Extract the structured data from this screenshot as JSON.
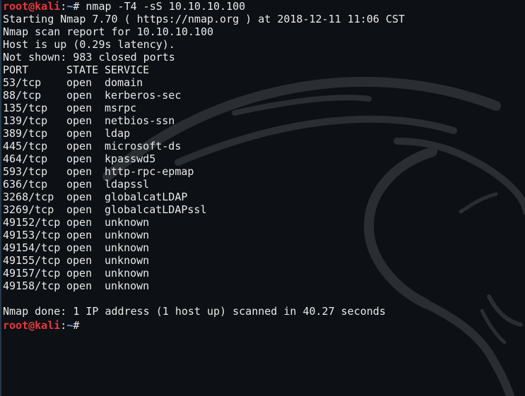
{
  "colors": {
    "background": "#0d1014",
    "text": "#e9e9e9",
    "prompt_user": "#e8383d",
    "prompt_path": "#6aa6f0"
  },
  "prompt": {
    "user": "root@kali",
    "sep": ":",
    "path": "~",
    "symbol": "# "
  },
  "command": "nmap -T4 -sS 10.10.10.100",
  "header_lines": [
    "Starting Nmap 7.70 ( https://nmap.org ) at 2018-12-11 11:06 CST",
    "Nmap scan report for 10.10.10.100",
    "Host is up (0.29s latency).",
    "Not shown: 983 closed ports"
  ],
  "table": {
    "headers": [
      "PORT",
      "STATE",
      "SERVICE"
    ],
    "rows": [
      [
        "53/tcp",
        "open",
        "domain"
      ],
      [
        "88/tcp",
        "open",
        "kerberos-sec"
      ],
      [
        "135/tcp",
        "open",
        "msrpc"
      ],
      [
        "139/tcp",
        "open",
        "netbios-ssn"
      ],
      [
        "389/tcp",
        "open",
        "ldap"
      ],
      [
        "445/tcp",
        "open",
        "microsoft-ds"
      ],
      [
        "464/tcp",
        "open",
        "kpasswd5"
      ],
      [
        "593/tcp",
        "open",
        "http-rpc-epmap"
      ],
      [
        "636/tcp",
        "open",
        "ldapssl"
      ],
      [
        "3268/tcp",
        "open",
        "globalcatLDAP"
      ],
      [
        "3269/tcp",
        "open",
        "globalcatLDAPssl"
      ],
      [
        "49152/tcp",
        "open",
        "unknown"
      ],
      [
        "49153/tcp",
        "open",
        "unknown"
      ],
      [
        "49154/tcp",
        "open",
        "unknown"
      ],
      [
        "49155/tcp",
        "open",
        "unknown"
      ],
      [
        "49157/tcp",
        "open",
        "unknown"
      ],
      [
        "49158/tcp",
        "open",
        "unknown"
      ]
    ]
  },
  "footer_line": "Nmap done: 1 IP address (1 host up) scanned in 40.27 seconds",
  "background_logo": "kali-dragon-watermark"
}
